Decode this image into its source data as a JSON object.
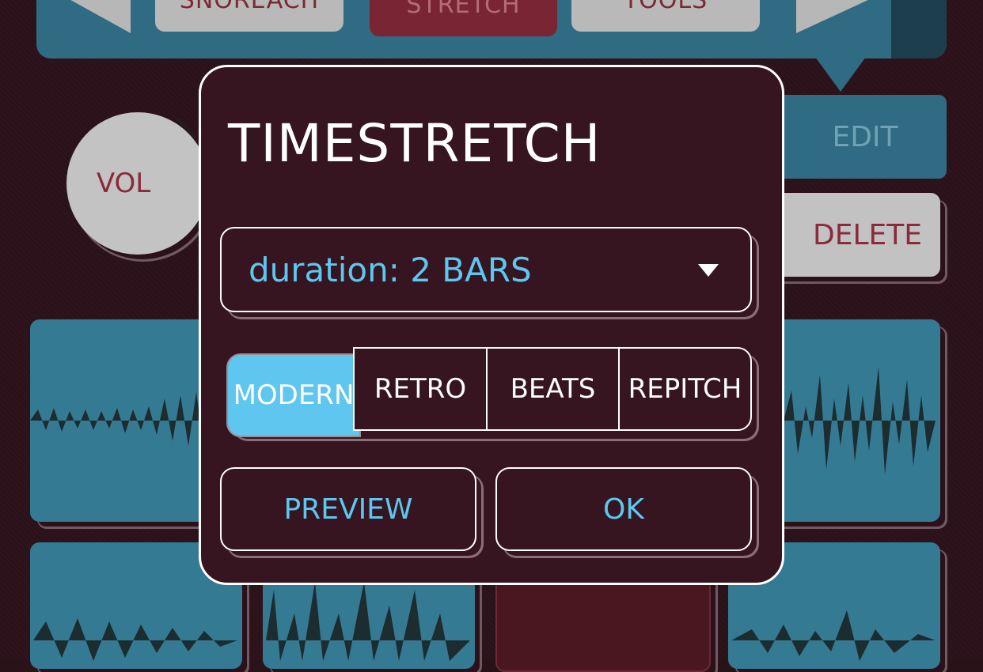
{
  "toolbar": {
    "buttons": [
      {
        "label": "SNOREACH"
      },
      {
        "label": "STRETCH"
      },
      {
        "label": "TOOLS"
      }
    ]
  },
  "side_buttons": {
    "edit_label": "EDIT",
    "delete_label": "DELETE"
  },
  "knob": {
    "label": "VOL"
  },
  "dialog": {
    "title": "TIMESTRETCH",
    "duration_select": {
      "value": "duration: 2 BARS"
    },
    "modes": [
      {
        "label": "MODERN",
        "selected": true
      },
      {
        "label": "RETRO",
        "selected": false
      },
      {
        "label": "BEATS",
        "selected": false
      },
      {
        "label": "REPITCH",
        "selected": false
      }
    ],
    "preview_label": "PREVIEW",
    "ok_label": "OK"
  },
  "colors": {
    "background": "#2b1119",
    "panel_teal": "#2f6b82",
    "dialog_bg": "#361420",
    "accent_blue": "#5ac8f0",
    "accent_red": "#8a2a3a"
  }
}
